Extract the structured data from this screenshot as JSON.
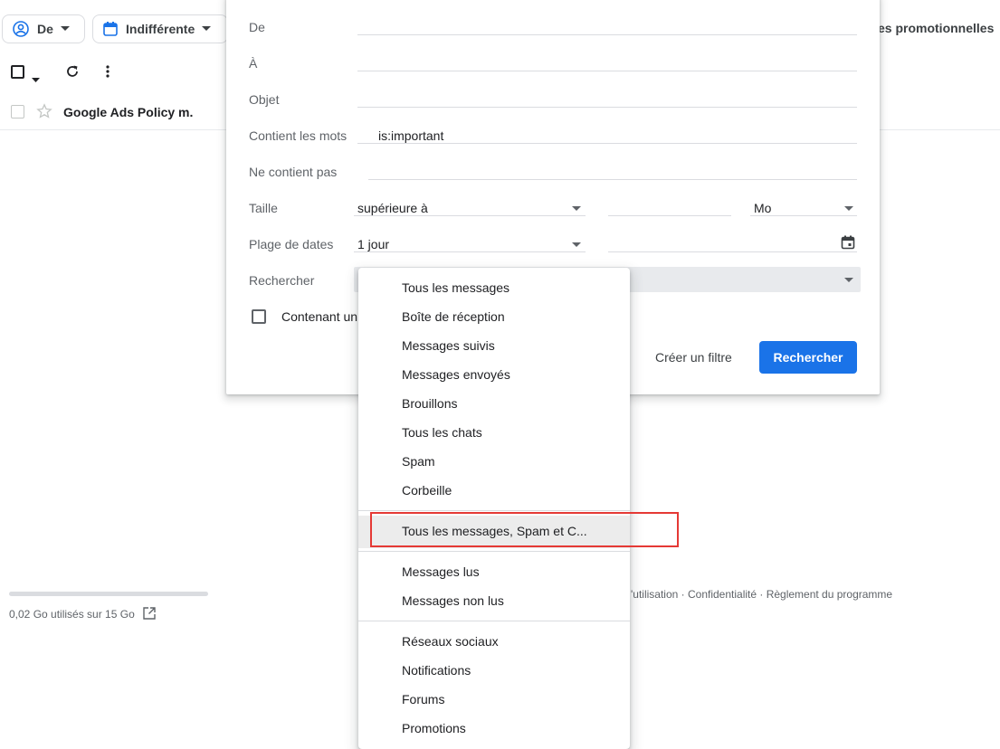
{
  "filters": {
    "from_chip": "De",
    "date_chip": "Indifférente",
    "promo_text": "es promotionnelles"
  },
  "mail": {
    "sender": "Google Ads Policy m."
  },
  "storage": {
    "text": "0,02 Go utilisés sur 15 Go"
  },
  "footer": {
    "links": "'utilisation · Confidentialité · Règlement du programme"
  },
  "search_panel": {
    "de_label": "De",
    "a_label": "À",
    "objet_label": "Objet",
    "contient_label": "Contient les mots",
    "contient_value": "is:important",
    "ne_contient_label": "Ne contient pas",
    "taille_label": "Taille",
    "taille_operator": "supérieure à",
    "taille_unit": "Mo",
    "plage_label": "Plage de dates",
    "plage_value": "1 jour",
    "rechercher_label": "Rechercher",
    "attachment_label": "Contenant un",
    "create_filter": "Créer un filtre",
    "search_button": "Rechercher"
  },
  "dropdown": {
    "group1": [
      "Tous les messages",
      "Boîte de réception",
      "Messages suivis",
      "Messages envoyés",
      "Brouillons",
      "Tous les chats",
      "Spam",
      "Corbeille"
    ],
    "group2": [
      "Tous les messages, Spam et C..."
    ],
    "group3": [
      "Messages lus",
      "Messages non lus"
    ],
    "group4": [
      "Réseaux sociaux",
      "Notifications",
      "Forums",
      "Promotions"
    ]
  }
}
